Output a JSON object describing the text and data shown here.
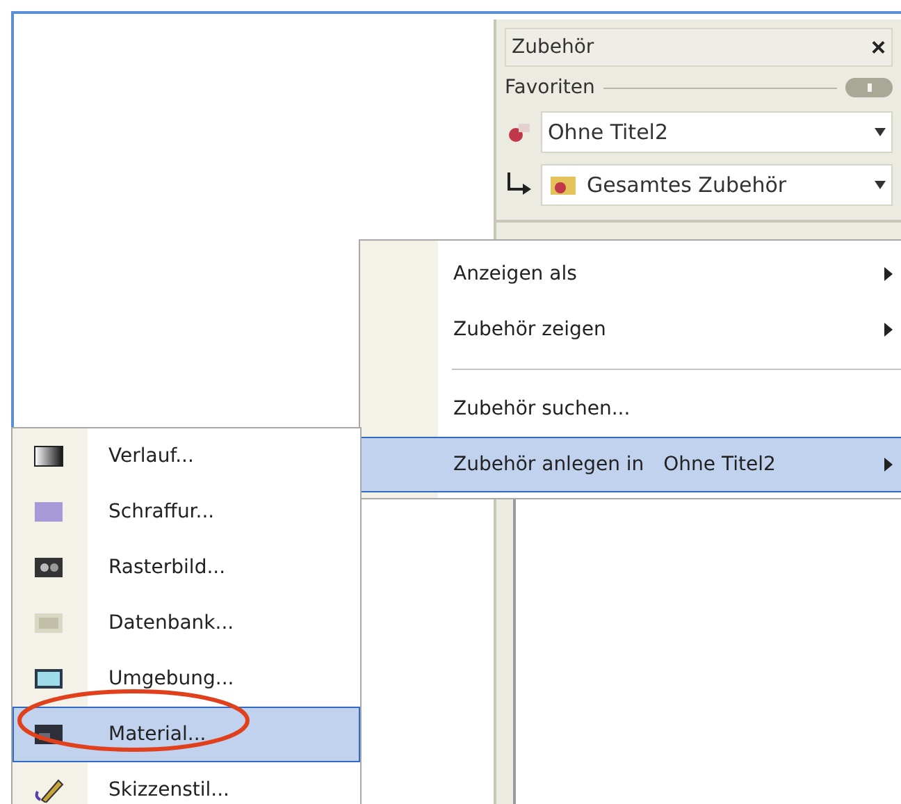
{
  "panel": {
    "title": "Zubehör",
    "close": "×",
    "section": "Favoriten",
    "library_dropdown": "Ohne Titel2",
    "category_dropdown": "Gesamtes Zubehör"
  },
  "context_menu": {
    "items": [
      {
        "kind": "item",
        "label": "Anzeigen als",
        "submenu": true,
        "selected": false
      },
      {
        "kind": "item",
        "label": "Zubehör zeigen",
        "submenu": true,
        "selected": false
      },
      {
        "kind": "separator"
      },
      {
        "kind": "item",
        "label": "Zubehör suchen...",
        "submenu": false,
        "selected": false
      },
      {
        "kind": "item",
        "label": "Zubehör anlegen in",
        "target": "Ohne Titel2",
        "submenu": true,
        "selected": true
      }
    ]
  },
  "submenu": {
    "items": [
      {
        "label": "Verlauf...",
        "kind": "gradient",
        "selected": false
      },
      {
        "label": "Schraffur...",
        "kind": "hatch",
        "selected": false
      },
      {
        "label": "Rasterbild...",
        "kind": "image",
        "selected": false
      },
      {
        "label": "Datenbank...",
        "kind": "database",
        "selected": false
      },
      {
        "label": "Umgebung...",
        "kind": "environment",
        "selected": false
      },
      {
        "label": "Material...",
        "kind": "material",
        "selected": true,
        "circled": true
      },
      {
        "label": "Skizzenstil...",
        "kind": "sketch",
        "selected": false
      }
    ]
  }
}
